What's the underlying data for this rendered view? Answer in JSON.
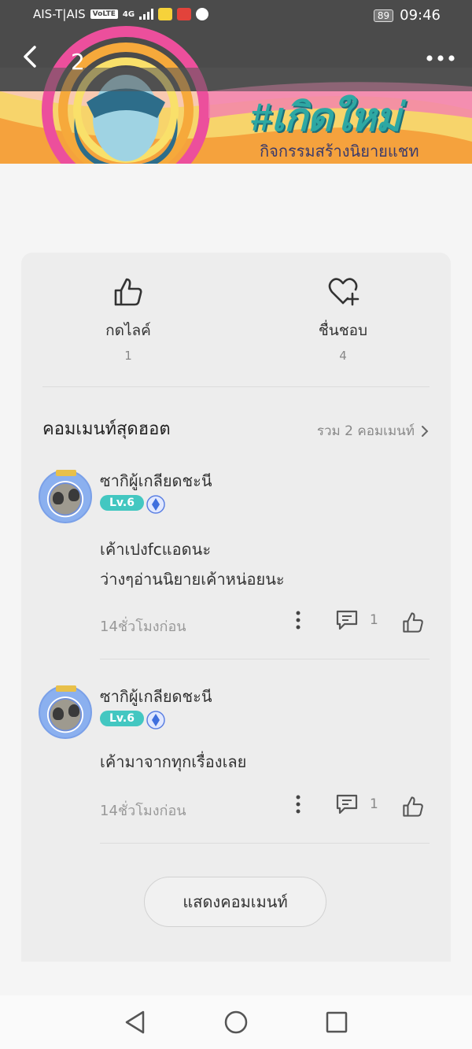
{
  "status_bar": {
    "carrier": "AIS-T|AIS",
    "volte": "VoLTE",
    "network": "4G",
    "battery": "89",
    "time": "09:46"
  },
  "header": {
    "episode_number": "2",
    "banner_title": "#เกิดใหม่",
    "banner_subtitle": "กิจกรรมสร้างนิยายแชท"
  },
  "reactions": {
    "like_label": "กดไลค์",
    "like_count": "1",
    "fav_label": "ชื่นชอบ",
    "fav_count": "4"
  },
  "comments_section": {
    "title": "คอมเมนท์สุดฮอต",
    "total": "รวม 2 คอมเมนท์",
    "show_button": "แสดงคอมเมนท์"
  },
  "comments": [
    {
      "name": "ซากิผู้เกลียดชะนี",
      "level": "Lv.6",
      "text_lines": [
        "เค้าเปงfcแอดนะ",
        "ว่างๆอ่านนิยายเค้าหน่อยนะ"
      ],
      "time": "14ชั่วโมงก่อน",
      "replies": "1"
    },
    {
      "name": "ซากิผู้เกลียดชะนี",
      "level": "Lv.6",
      "text_lines": [
        "เค้ามาจากทุกเรื่องเลย"
      ],
      "time": "14ชั่วโมงก่อน",
      "replies": "1"
    }
  ],
  "colors": {
    "level_badge": "#43c7c1",
    "banner_title": "#2ea8a3",
    "card_bg": "#ededed"
  }
}
